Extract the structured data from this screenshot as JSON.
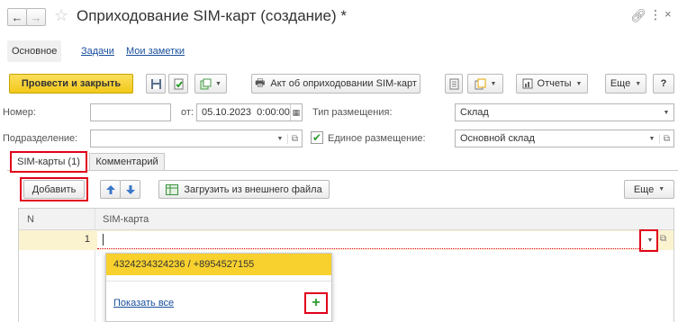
{
  "window": {
    "title": "Оприходование SIM-карт (создание) *"
  },
  "sections": [
    {
      "label": "Основное"
    },
    {
      "label": "Задачи"
    },
    {
      "label": "Мои заметки"
    }
  ],
  "toolbar": {
    "post_close": "Провести и закрыть",
    "act_button": "Акт об оприходовании SIM-карт",
    "reports": "Отчеты",
    "more": "Еще",
    "help": "?"
  },
  "form": {
    "number_label": "Номер:",
    "number_value": "",
    "date_label": "от:",
    "date_value": "05.10.2023  0:00:00",
    "placement_type_label": "Тип размещения:",
    "placement_type_value": "Склад",
    "department_label": "Подразделение:",
    "department_value": "",
    "single_placement_label": "Единое размещение:",
    "single_placement_checked": true,
    "single_placement_value": "Основной склад"
  },
  "tabs": [
    {
      "label": "SIM-карты (1)"
    },
    {
      "label": "Комментарий"
    }
  ],
  "table_toolbar": {
    "add": "Добавить",
    "load_external": "Загрузить из внешнего файла",
    "more": "Еще"
  },
  "table": {
    "columns": [
      "N",
      "SIM-карта"
    ],
    "rows": [
      {
        "n": "1",
        "sim": ""
      }
    ]
  },
  "dropdown": {
    "items": [
      "4324234324236 / +8954527155"
    ],
    "show_all": "Показать все"
  },
  "colors": {
    "accent_yellow": "#f8d12e",
    "highlight_red": "#e0001b",
    "link_blue": "#1a4f9c",
    "add_green": "#2e9b2e"
  }
}
